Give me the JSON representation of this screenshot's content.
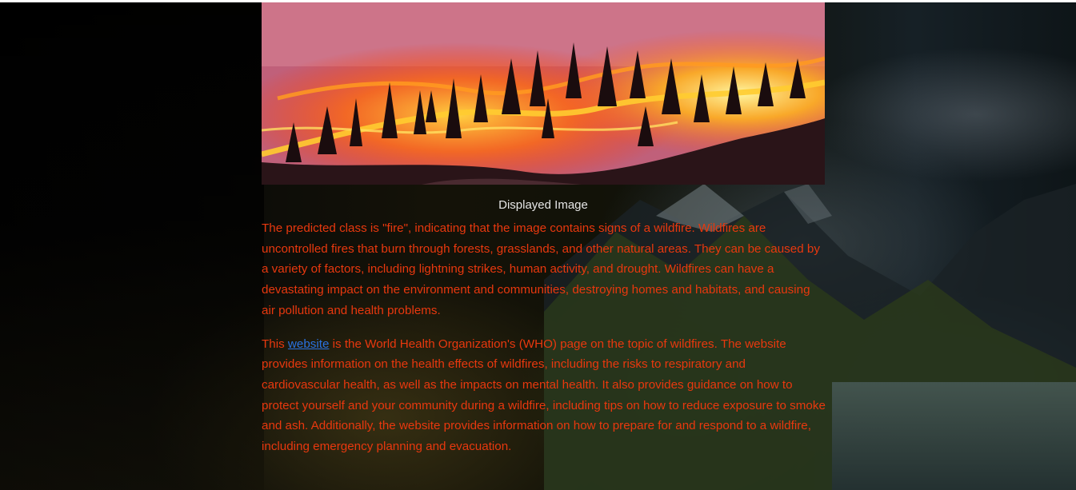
{
  "image": {
    "caption": "Displayed Image"
  },
  "prediction": {
    "text": "The predicted class is \"fire\", indicating that the image contains signs of a wildfire. Wildfires are uncontrolled fires that burn through forests, grasslands, and other natural areas. They can be caused by a variety of factors, including lightning strikes, human activity, and drought. Wildfires can have a devastating impact on the environment and communities, destroying homes and habitats, and causing air pollution and health problems."
  },
  "resource": {
    "prefix": "This ",
    "link_text": "website",
    "suffix": " is the World Health Organization's (WHO) page on the topic of wildfires. The website provides information on the health effects of wildfires, including the risks to respiratory and cardiovascular health, as well as the impacts on mental health. It also provides guidance on how to protect yourself and your community during a wildfire, including tips on how to reduce exposure to smoke and ash. Additionally, the website provides information on how to prepare for and respond to a wildfire, including emergency planning and evacuation."
  },
  "colors": {
    "text_accent": "#e8380e",
    "link": "#2a72e0",
    "caption": "#e6e6e6"
  },
  "icons": [
    "wildfire-photo",
    "mountain-lake-background"
  ]
}
